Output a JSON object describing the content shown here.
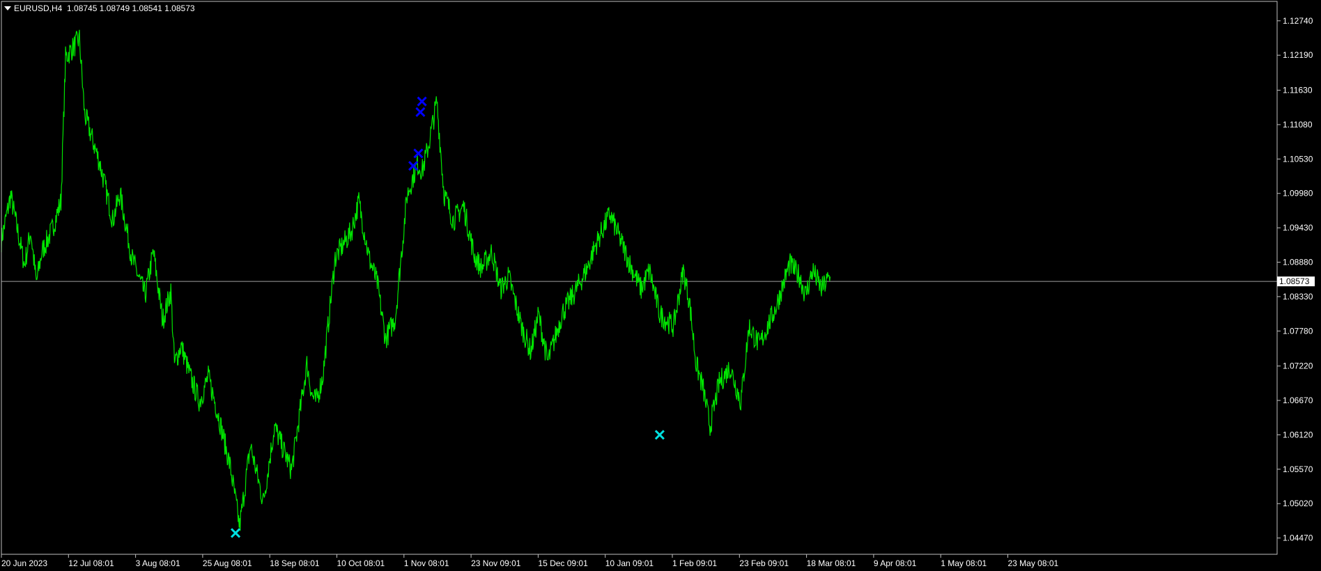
{
  "header": {
    "symbol_timeframe": "EURUSD,H4",
    "ohlc": "1.08745 1.08749 1.08541 1.08573"
  },
  "chart_data": {
    "type": "line",
    "symbol": "EURUSD",
    "timeframe": "H4",
    "colors": {
      "background": "#000000",
      "frame": "#c0c0c0",
      "price_line": "#00e600",
      "current_price_line": "#a0a0a0",
      "marker_high": "#0000ff",
      "marker_low": "#00e0e0",
      "text": "#ffffff"
    },
    "current_price": 1.08573,
    "current_price_label": "1.08573",
    "ylim": [
      1.0421,
      1.1305
    ],
    "y_ticks": [
      "1.12740",
      "1.12190",
      "1.11630",
      "1.11080",
      "1.10530",
      "1.09980",
      "1.09430",
      "1.08880",
      "1.08330",
      "1.07780",
      "1.07220",
      "1.06670",
      "1.06120",
      "1.05570",
      "1.05020",
      "1.04470"
    ],
    "x_ticks": [
      "20 Jun 2023",
      "12 Jul 08:01",
      "3 Aug 08:01",
      "25 Aug 08:01",
      "18 Sep 08:01",
      "10 Oct 08:01",
      "1 Nov 08:01",
      "23 Nov 09:01",
      "15 Dec 09:01",
      "10 Jan 09:01",
      "1 Feb 09:01",
      "23 Feb 09:01",
      "18 Mar 08:01",
      "9 Apr 08:01",
      "1 May 08:01",
      "23 May 08:01"
    ],
    "bar_index_range": [
      0,
      1500
    ],
    "x_tick_bar_index": [
      0,
      106,
      212,
      317,
      423,
      528,
      634,
      740,
      845,
      951,
      1056,
      1162,
      1267,
      1373,
      1479,
      1584
    ],
    "series": [
      {
        "x": [
          0,
          18,
          45,
          57,
          68,
          79,
          98,
          116,
          125,
          152,
          162,
          192,
          217,
          231,
          254,
          280,
          296,
          314,
          330,
          337,
          350,
          368,
          386,
          403,
          422,
          446,
          464,
          485,
          510,
          532,
          565,
          595,
          605,
          613,
          626,
          650,
          682,
          696,
          716,
          732,
          748,
          767,
          790,
          810,
          820,
          832,
          848,
          862,
          880,
          900,
          921,
          935,
          955,
          972,
          988,
          1013,
          1031,
          1046,
          1064,
          1093,
          1118,
          1139,
          1157,
          1185,
          1210,
          1224,
          1246,
          1262,
          1282,
          1309,
          1328,
          1340,
          1353,
          1367,
          1380,
          1398,
          1419,
          1440,
          1456,
          1476,
          1508,
          1535,
          1555,
          1566,
          1580,
          1597,
          1614
        ],
        "y": [
          1.0923,
          1.0995,
          1.0883,
          1.0938,
          1.0855,
          1.0905,
          1.0938,
          1.0985,
          1.1215,
          1.1245,
          1.1125,
          1.1045,
          1.0955,
          1.0998,
          1.0895,
          1.0835,
          1.0905,
          1.0795,
          1.0842,
          1.0725,
          1.0755,
          1.0705,
          1.0665,
          1.0705,
          1.0645,
          1.056,
          1.0465,
          1.0595,
          1.0505,
          1.0625,
          1.0555,
          1.0725,
          1.0675,
          1.0665,
          1.0705,
          1.0895,
          1.0938,
          1.0985,
          1.0895,
          1.0855,
          1.0765,
          1.0798,
          1.0995,
          1.1045,
          1.1035,
          1.1075,
          1.1145,
          1.0998,
          1.0955,
          1.0978,
          1.0898,
          1.0878,
          1.0905,
          1.0845,
          1.0865,
          1.0785,
          1.0745,
          1.0805,
          1.0728,
          1.0808,
          1.0842,
          1.0875,
          1.0915,
          1.0965,
          1.0915,
          1.0885,
          1.0845,
          1.0875,
          1.0805,
          1.0785,
          1.0875,
          1.0825,
          1.0725,
          1.0685,
          1.0625,
          1.0695,
          1.072,
          1.0665,
          1.0785,
          1.0755,
          1.0815,
          1.0885,
          1.0865,
          1.0835,
          1.0875,
          1.0845,
          1.0865
        ]
      }
    ],
    "markers": [
      {
        "kind": "swing-high",
        "color": "#0000ff",
        "x": 802,
        "y": 1.1042
      },
      {
        "kind": "swing-high",
        "color": "#0000ff",
        "x": 812,
        "y": 1.1062
      },
      {
        "kind": "swing-high",
        "color": "#0000ff",
        "x": 816,
        "y": 1.1128
      },
      {
        "kind": "swing-high",
        "color": "#0000ff",
        "x": 819,
        "y": 1.1145
      },
      {
        "kind": "swing-low",
        "color": "#00e0e0",
        "x": 456,
        "y": 1.0455
      },
      {
        "kind": "swing-low",
        "color": "#00e0e0",
        "x": 1282,
        "y": 1.0612
      }
    ]
  }
}
